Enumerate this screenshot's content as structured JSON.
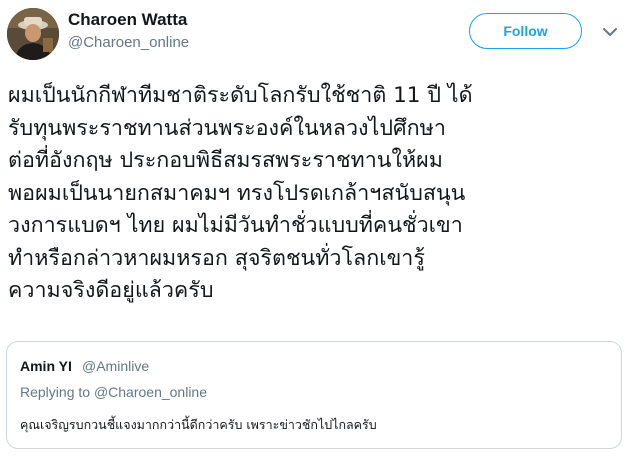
{
  "author": {
    "display_name": "Charoen Watta",
    "handle": "@Charoen_online",
    "avatar_icon": "user-avatar-photo"
  },
  "actions": {
    "follow_label": "Follow",
    "menu_icon": "chevron-down-icon"
  },
  "tweet": {
    "lines": [
      "ผมเป็นนักกีฬาทีมชาติระดับโลกรับใช้ชาติ 11 ปี ได้",
      "รับทุนพระราชทานส่วนพระองค์ในหลวงไปศึกษา",
      "ต่อที่อังกฤษ ประกอบพิธีสมรสพระราชทานให้ผม",
      "พอผมเป็นนายกสมาคมฯ ทรงโปรดเกล้าฯสนับสนุน",
      "วงการแบดฯ ไทย ผมไม่มีวันทำชั่วแบบที่คนชั่วเขา",
      "ทำหรือกล่าวหาผมหรอก สุจริตชนทั่วโลกเขารู้",
      "ความจริงดีอยู่แล้วครับ"
    ]
  },
  "quoted_tweet": {
    "display_name": "Amin YI",
    "handle": "@Aminlive",
    "replying_prefix": "Replying to",
    "replying_to": "@Charoen_online",
    "text": "คุณเจริญรบกวนชี้แจงมากกว่านี้ดีกว่าครับ เพราะข่าวชักไปไกลครับ"
  },
  "colors": {
    "accent": "#1da1f2",
    "text_primary": "#14171a",
    "text_secondary": "#657786",
    "border": "#ccd6dd"
  }
}
